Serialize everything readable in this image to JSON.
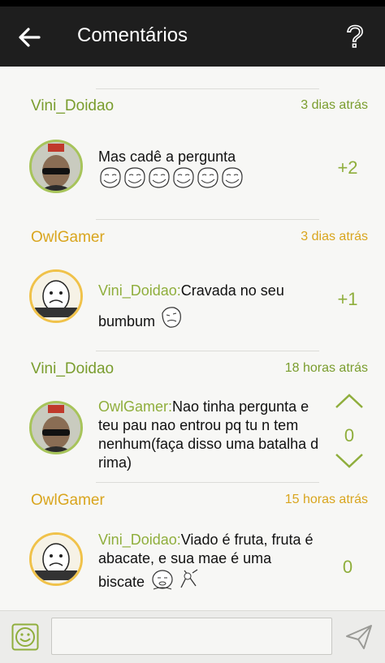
{
  "header": {
    "title": "Comentários",
    "help_label": "?"
  },
  "colors": {
    "app_bar": "#1e1e1e",
    "username_green": "#7a9d2e",
    "username_orange": "#d9a51e",
    "score": "#8fae3c"
  },
  "comments": [
    {
      "author": "Vini_Doidao",
      "time": "3 dias atrás",
      "avatar": "photo-avatar",
      "mention": "",
      "text": "Mas cadê a pergunta",
      "score": "+2",
      "memes": [
        "troll-face-icon",
        "troll-face-icon",
        "troll-face-icon",
        "troll-face-icon",
        "troll-face-icon",
        "troll-face-icon"
      ]
    },
    {
      "author": "OwlGamer",
      "time": "3 dias atrás",
      "avatar": "cereal-guy-avatar",
      "mention": "Vini_Doidao:",
      "text": "Cravada no seu",
      "text2": "bumbum",
      "score": "+1",
      "memes": [
        "meme-face-icon"
      ]
    },
    {
      "author": "Vini_Doidao",
      "time": "18 horas atrás",
      "avatar": "photo-avatar",
      "mention": "OwlGamer:",
      "text": "Nao tinha pergunta e teu pau nao entrou pq tu n tem nenhum(faça disso uma batalha d rima)",
      "score": "0",
      "memes": []
    },
    {
      "author": "OwlGamer",
      "time": "15 horas atrás",
      "avatar": "cereal-guy-avatar",
      "mention": "Vini_Doidao:",
      "text": "Viado é fruta, fruta é abacate, e sua mae é uma",
      "text2": "biscate",
      "score": "0",
      "memes": [
        "meme-face-icon",
        "meme-face-icon"
      ]
    }
  ],
  "composer": {
    "value": "",
    "placeholder": ""
  }
}
